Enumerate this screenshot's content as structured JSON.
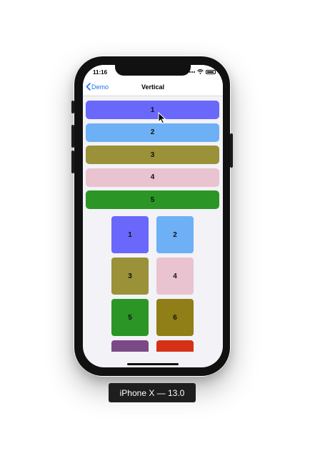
{
  "status_bar": {
    "time": "11:16"
  },
  "nav": {
    "back_label": "Demo",
    "title": "Vertical"
  },
  "list_rows": [
    {
      "label": "1",
      "color": "#6a67fb"
    },
    {
      "label": "2",
      "color": "#6db0f5"
    },
    {
      "label": "3",
      "color": "#9a9138"
    },
    {
      "label": "4",
      "color": "#e9c3cf"
    },
    {
      "label": "5",
      "color": "#2b9625"
    }
  ],
  "grid_cells": [
    {
      "label": "1",
      "color": "#6a67fb"
    },
    {
      "label": "2",
      "color": "#6db0f5"
    },
    {
      "label": "3",
      "color": "#9a9138"
    },
    {
      "label": "4",
      "color": "#e9c3cf"
    },
    {
      "label": "5",
      "color": "#2b9625"
    },
    {
      "label": "6",
      "color": "#907e16"
    },
    {
      "label": "",
      "color": "#7b4a86"
    },
    {
      "label": "",
      "color": "#d43117"
    }
  ],
  "device_label": "iPhone X — 13.0",
  "colors": {
    "accent": "#1a73e8",
    "screen_bg": "#f2f2f7"
  },
  "icons": {
    "back": "chevron-left-icon",
    "cursor": "mouse-pointer-icon",
    "wifi": "wifi-icon",
    "battery": "battery-icon",
    "signal": "cellular-signal-icon"
  }
}
